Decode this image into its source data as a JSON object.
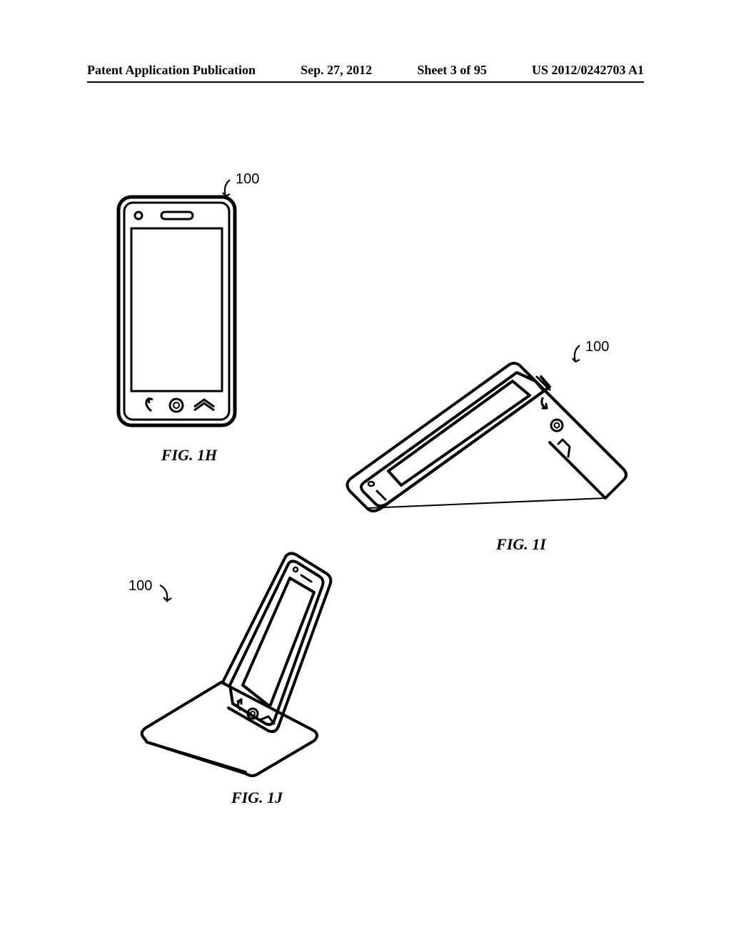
{
  "header": {
    "pub_type": "Patent Application Publication",
    "date": "Sep. 27, 2012",
    "sheet": "Sheet 3 of 95",
    "pub_number": "US 2012/0242703 A1"
  },
  "figures": {
    "fig1h": {
      "label": "FIG. 1H",
      "ref": "100"
    },
    "fig1i": {
      "label": "FIG. 1I",
      "ref": "100"
    },
    "fig1j": {
      "label": "FIG. 1J",
      "ref": "100"
    }
  }
}
